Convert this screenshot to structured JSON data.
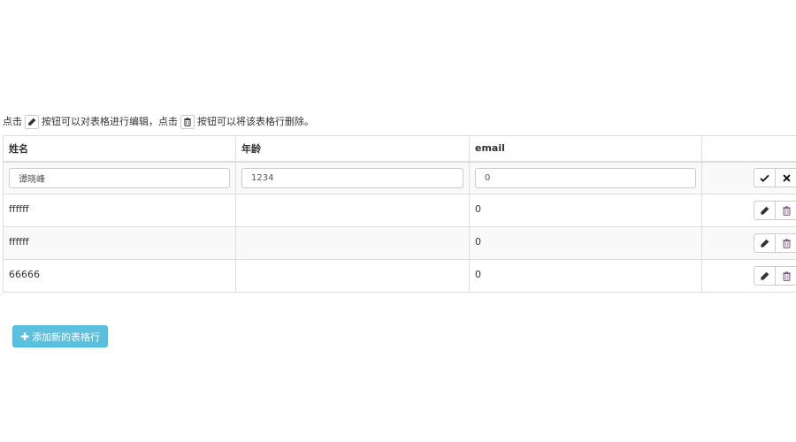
{
  "hint": {
    "part1": "点击",
    "part2": "按钮可以对表格进行编辑，点击",
    "part3": "按钮可以将该表格行删除。"
  },
  "table": {
    "columns": [
      "姓名",
      "年龄",
      "email",
      ""
    ],
    "editing_row": {
      "name": "谭晓峰",
      "age": "1234",
      "email": "0"
    },
    "rows": [
      {
        "name": "ffffff",
        "age": "",
        "email": "0"
      },
      {
        "name": "ffffff",
        "age": "",
        "email": "0"
      },
      {
        "name": "66666",
        "age": "",
        "email": "0"
      }
    ]
  },
  "add_button": {
    "icon": "plus-icon",
    "label": "添加新的表格行"
  },
  "colors": {
    "accent": "#5bc0de",
    "border": "#dddddd",
    "stripe": "#f9f9f9",
    "delete_icon": "#7d5a7d"
  }
}
